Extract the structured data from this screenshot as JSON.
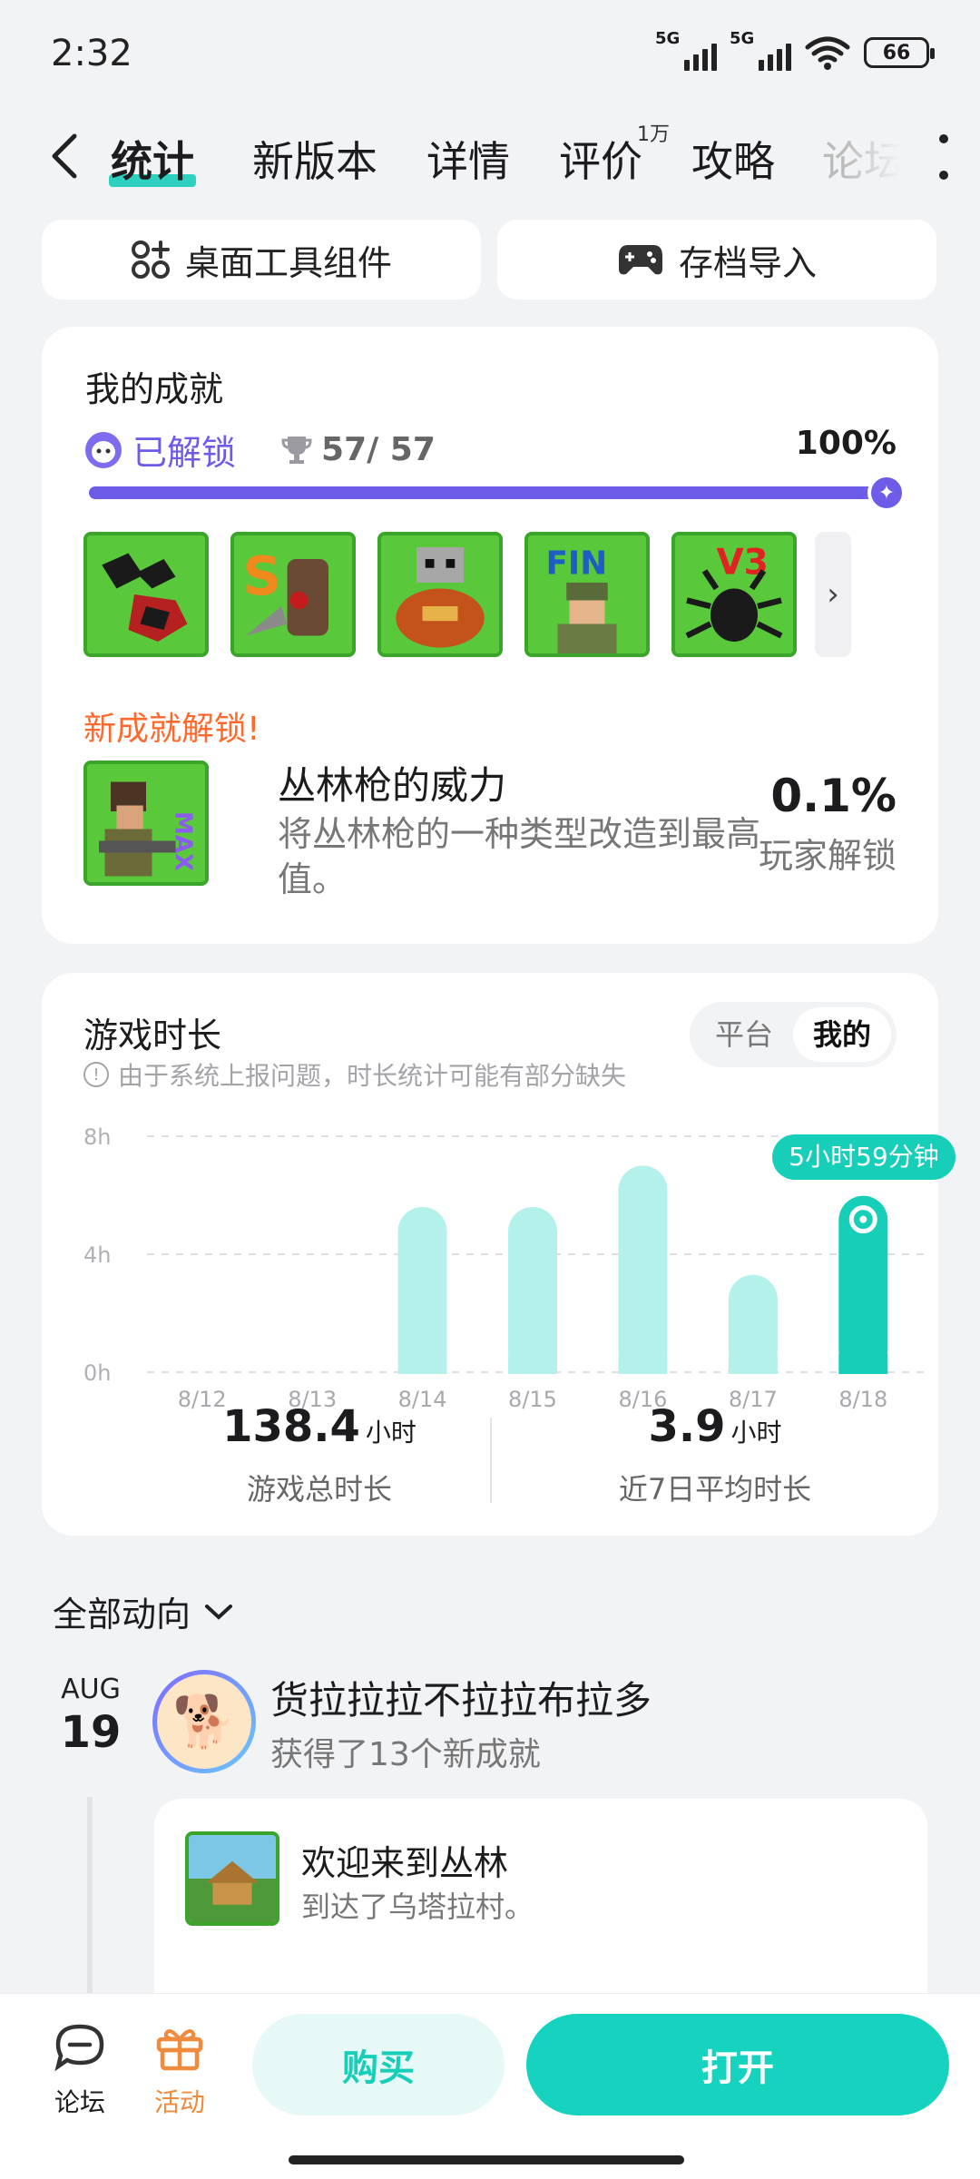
{
  "status_bar": {
    "time": "2:32",
    "network_1": "5G",
    "network_2": "5G",
    "battery": "66"
  },
  "tabs": [
    {
      "label": "统计",
      "active": true
    },
    {
      "label": "新版本"
    },
    {
      "label": "详情"
    },
    {
      "label": "评价",
      "badge": "1万"
    },
    {
      "label": "攻略"
    },
    {
      "label": "论坛"
    }
  ],
  "actions": {
    "widget_label": "桌面工具组件",
    "save_import_label": "存档导入"
  },
  "achievements": {
    "title": "我的成就",
    "unlocked_label": "已解锁",
    "count": "57/ 57",
    "percent": "100%",
    "progress": 1.0,
    "thumbs": [
      "scorpion-badge",
      "s-rank-badge",
      "golem-badge",
      "fin-badge",
      "v3-beetle-badge"
    ],
    "new_label": "新成就解锁!",
    "new_item": {
      "name": "丛林枪的威力",
      "desc": "将丛林枪的一种类型改造到最高值。",
      "rate": "0.1%",
      "rate_label": "玩家解锁",
      "thumb_text": "MAX"
    }
  },
  "playtime": {
    "title": "游戏时长",
    "note": "由于系统上报问题，时长统计可能有部分缺失",
    "toggle": {
      "platform": "平台",
      "mine": "我的"
    },
    "tooltip": "5小时59分钟",
    "total_value": "138.4",
    "total_unit": "小时",
    "total_label": "游戏总时长",
    "avg_value": "3.9",
    "avg_unit": "小时",
    "avg_label": "近7日平均时长"
  },
  "chart_data": {
    "type": "bar",
    "categories": [
      "8/12",
      "8/13",
      "8/14",
      "8/15",
      "8/16",
      "8/17",
      "8/18"
    ],
    "values": [
      0,
      0,
      5.6,
      5.6,
      7.0,
      3.3,
      5.98
    ],
    "y_ticks": [
      "0h",
      "4h",
      "8h"
    ],
    "ylim": [
      0,
      8
    ],
    "highlight_index": 6,
    "grid": true,
    "bar_color": "#b4f1ea",
    "highlight_color": "#17cfb9"
  },
  "feed": {
    "title": "全部动向",
    "month": "AUG",
    "day": "19",
    "user": "货拉拉拉不拉拉布拉多",
    "summary": "获得了13个新成就",
    "item_title": "欢迎来到丛林",
    "item_desc": "到达了乌塔拉村。"
  },
  "bottom": {
    "forum_label": "论坛",
    "activity_label": "活动",
    "buy_label": "购买",
    "open_label": "打开"
  },
  "colors": {
    "accent": "#17cfb9",
    "purple": "#6c5ce7",
    "orange": "#ff6a2c"
  }
}
